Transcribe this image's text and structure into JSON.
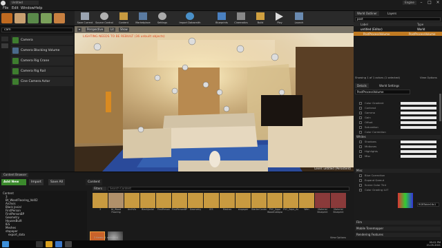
{
  "window": {
    "tab_title": "Untitled",
    "user": "Engine",
    "menu": [
      "File",
      "Edit",
      "Window",
      "Help"
    ]
  },
  "modes": {
    "search_value": "cam",
    "items": [
      "Camera",
      "Camera Blocking Volume",
      "Camera Rig Crane",
      "Camera Rig Rail",
      "Cine Camera Actor"
    ]
  },
  "toolbar": [
    "Save Current",
    "Source Control",
    "Content",
    "Marketplace",
    "Settings",
    "Blueprints",
    "Cinematics",
    "Build",
    "Play",
    "Launch"
  ],
  "toolbar_extra": [
    "Import Datasmith"
  ],
  "viewport": {
    "buttons": [
      "Perspective",
      "Lit",
      "Show"
    ],
    "warning": "LIGHTING NEEDS TO BE REBUILT (36 unbuilt objects)",
    "status": "Level: untitled (Persistent)"
  },
  "outliner": {
    "tabs": [
      "World Outliner",
      "Layers"
    ],
    "search": "post",
    "headers": [
      "Label",
      "Type"
    ],
    "rows": [
      {
        "label": "untitled (Editor)",
        "type": "World"
      },
      {
        "label": "PostProcessVolume",
        "type": "PostProcessVolume"
      }
    ],
    "showing": "Showing 1 of 1 actors (1 selected)",
    "view_options": "View Options"
  },
  "details": {
    "tab": "Details",
    "world_settings": "World Settings",
    "name": "PostProcessVolume",
    "props_top": [
      "Color Gradient",
      "Contrast",
      "Gamma",
      "Gain",
      "Offset",
      "Saturation",
      "Color Correction"
    ],
    "props_mid": [
      "Shadows",
      "Midtones",
      "Highlights",
      "Misc"
    ],
    "sections": [
      "Whites",
      "Misc"
    ],
    "props_misc": [
      "Blue Correction",
      "Expand Gamut",
      "Scene Color Tint",
      "Color Grading LUT"
    ],
    "lut_value": "RGBTable16x1",
    "bottom_sections": [
      "Film",
      "Mobile Tonemapper",
      "Rendering Features"
    ]
  },
  "content": {
    "tab": "Content Browser",
    "add_new": "Add New",
    "import": "Import",
    "save_all": "Save All",
    "path": "Content",
    "filters": "Filters",
    "search_placeholder": "Search Content",
    "tree": [
      "Content",
      "3",
      "Bt_WoodFlooring_Vol02",
      "Archvis",
      "Black Jovial",
      "FirstPerson",
      "FirstPersonBP",
      "Geometry",
      "HousesBuilt",
      "IES",
      "Meshes",
      "stapaper",
      "export_data"
    ],
    "assets": [
      "3",
      "bt_Wood Flooring Vol02",
      "ArchVis",
      "BlackJovial",
      "FirstPerson",
      "FirstPersonBP",
      "Geometry",
      "IES",
      "Meshes",
      "stapaper",
      "StarterContent",
      "PVC_Sapo WoodCollapse",
      "PVC_Sapo_Assets",
      "Wen",
      "Material Blueprint",
      "Material Blueprint",
      "Post Process",
      "sphere_background"
    ],
    "status": "2 items (1 selected)",
    "view_options": "View Options"
  },
  "taskbar": {
    "time": "05:02 PM",
    "date": "21-05-2021"
  }
}
